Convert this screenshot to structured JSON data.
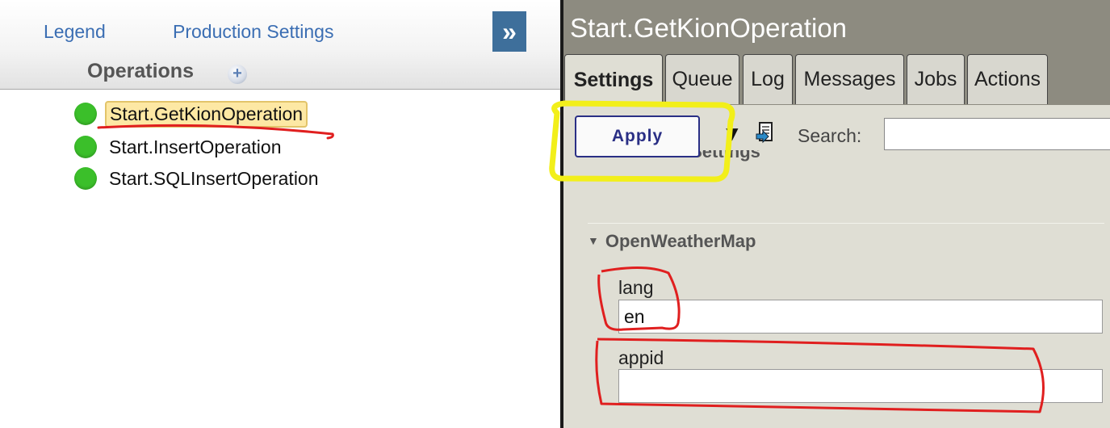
{
  "left_panel": {
    "links": {
      "legend": "Legend",
      "production_settings": "Production Settings"
    },
    "expand_glyph": "»",
    "operations_title": "Operations",
    "add_glyph": "+",
    "operations": [
      {
        "label": "Start.GetKionOperation",
        "status_color": "#3bbf2a",
        "selected": true
      },
      {
        "label": "Start.InsertOperation",
        "status_color": "#3bbf2a",
        "selected": false
      },
      {
        "label": "Start.SQLInsertOperation",
        "status_color": "#3bbf2a",
        "selected": false
      }
    ]
  },
  "right_panel": {
    "title": "Start.GetKionOperation",
    "tabs": [
      "Settings",
      "Queue",
      "Log",
      "Messages",
      "Jobs",
      "Actions"
    ],
    "active_tab": "Settings",
    "toolbar": {
      "apply_label": "Apply",
      "collapse_glyph": "▼",
      "search_label": "Search:",
      "search_value": ""
    },
    "sections": {
      "connection_settings": "Connection Settings",
      "openweathermap": "OpenWeatherMap"
    },
    "fields": {
      "lang": {
        "label": "lang",
        "value": "en"
      },
      "appid": {
        "label": "appid",
        "value": ""
      }
    }
  },
  "colors": {
    "link": "#3b6eb3",
    "expand_button": "#3e6f9b",
    "status_ok": "#3bbf2a",
    "header_bg": "#8d8b80",
    "panel_bg": "#dfded4",
    "apply_border": "#2a2f85",
    "annotation_yellow": "#f2ef1a",
    "annotation_red": "#e01f1f"
  },
  "icons": [
    "double-chevron-right-icon",
    "plus-circle-icon",
    "status-dot-icon",
    "triangle-down-icon",
    "document-arrow-icon"
  ]
}
